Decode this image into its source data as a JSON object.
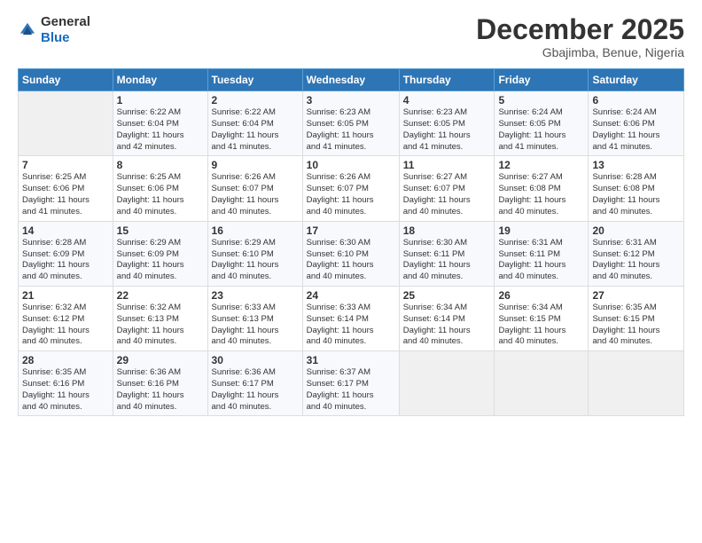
{
  "logo": {
    "general": "General",
    "blue": "Blue"
  },
  "header": {
    "month": "December 2025",
    "location": "Gbajimba, Benue, Nigeria"
  },
  "weekdays": [
    "Sunday",
    "Monday",
    "Tuesday",
    "Wednesday",
    "Thursday",
    "Friday",
    "Saturday"
  ],
  "weeks": [
    [
      {
        "day": "",
        "info": ""
      },
      {
        "day": "1",
        "info": "Sunrise: 6:22 AM\nSunset: 6:04 PM\nDaylight: 11 hours\nand 42 minutes."
      },
      {
        "day": "2",
        "info": "Sunrise: 6:22 AM\nSunset: 6:04 PM\nDaylight: 11 hours\nand 41 minutes."
      },
      {
        "day": "3",
        "info": "Sunrise: 6:23 AM\nSunset: 6:05 PM\nDaylight: 11 hours\nand 41 minutes."
      },
      {
        "day": "4",
        "info": "Sunrise: 6:23 AM\nSunset: 6:05 PM\nDaylight: 11 hours\nand 41 minutes."
      },
      {
        "day": "5",
        "info": "Sunrise: 6:24 AM\nSunset: 6:05 PM\nDaylight: 11 hours\nand 41 minutes."
      },
      {
        "day": "6",
        "info": "Sunrise: 6:24 AM\nSunset: 6:06 PM\nDaylight: 11 hours\nand 41 minutes."
      }
    ],
    [
      {
        "day": "7",
        "info": "Sunrise: 6:25 AM\nSunset: 6:06 PM\nDaylight: 11 hours\nand 41 minutes."
      },
      {
        "day": "8",
        "info": "Sunrise: 6:25 AM\nSunset: 6:06 PM\nDaylight: 11 hours\nand 40 minutes."
      },
      {
        "day": "9",
        "info": "Sunrise: 6:26 AM\nSunset: 6:07 PM\nDaylight: 11 hours\nand 40 minutes."
      },
      {
        "day": "10",
        "info": "Sunrise: 6:26 AM\nSunset: 6:07 PM\nDaylight: 11 hours\nand 40 minutes."
      },
      {
        "day": "11",
        "info": "Sunrise: 6:27 AM\nSunset: 6:07 PM\nDaylight: 11 hours\nand 40 minutes."
      },
      {
        "day": "12",
        "info": "Sunrise: 6:27 AM\nSunset: 6:08 PM\nDaylight: 11 hours\nand 40 minutes."
      },
      {
        "day": "13",
        "info": "Sunrise: 6:28 AM\nSunset: 6:08 PM\nDaylight: 11 hours\nand 40 minutes."
      }
    ],
    [
      {
        "day": "14",
        "info": "Sunrise: 6:28 AM\nSunset: 6:09 PM\nDaylight: 11 hours\nand 40 minutes."
      },
      {
        "day": "15",
        "info": "Sunrise: 6:29 AM\nSunset: 6:09 PM\nDaylight: 11 hours\nand 40 minutes."
      },
      {
        "day": "16",
        "info": "Sunrise: 6:29 AM\nSunset: 6:10 PM\nDaylight: 11 hours\nand 40 minutes."
      },
      {
        "day": "17",
        "info": "Sunrise: 6:30 AM\nSunset: 6:10 PM\nDaylight: 11 hours\nand 40 minutes."
      },
      {
        "day": "18",
        "info": "Sunrise: 6:30 AM\nSunset: 6:11 PM\nDaylight: 11 hours\nand 40 minutes."
      },
      {
        "day": "19",
        "info": "Sunrise: 6:31 AM\nSunset: 6:11 PM\nDaylight: 11 hours\nand 40 minutes."
      },
      {
        "day": "20",
        "info": "Sunrise: 6:31 AM\nSunset: 6:12 PM\nDaylight: 11 hours\nand 40 minutes."
      }
    ],
    [
      {
        "day": "21",
        "info": "Sunrise: 6:32 AM\nSunset: 6:12 PM\nDaylight: 11 hours\nand 40 minutes."
      },
      {
        "day": "22",
        "info": "Sunrise: 6:32 AM\nSunset: 6:13 PM\nDaylight: 11 hours\nand 40 minutes."
      },
      {
        "day": "23",
        "info": "Sunrise: 6:33 AM\nSunset: 6:13 PM\nDaylight: 11 hours\nand 40 minutes."
      },
      {
        "day": "24",
        "info": "Sunrise: 6:33 AM\nSunset: 6:14 PM\nDaylight: 11 hours\nand 40 minutes."
      },
      {
        "day": "25",
        "info": "Sunrise: 6:34 AM\nSunset: 6:14 PM\nDaylight: 11 hours\nand 40 minutes."
      },
      {
        "day": "26",
        "info": "Sunrise: 6:34 AM\nSunset: 6:15 PM\nDaylight: 11 hours\nand 40 minutes."
      },
      {
        "day": "27",
        "info": "Sunrise: 6:35 AM\nSunset: 6:15 PM\nDaylight: 11 hours\nand 40 minutes."
      }
    ],
    [
      {
        "day": "28",
        "info": "Sunrise: 6:35 AM\nSunset: 6:16 PM\nDaylight: 11 hours\nand 40 minutes."
      },
      {
        "day": "29",
        "info": "Sunrise: 6:36 AM\nSunset: 6:16 PM\nDaylight: 11 hours\nand 40 minutes."
      },
      {
        "day": "30",
        "info": "Sunrise: 6:36 AM\nSunset: 6:17 PM\nDaylight: 11 hours\nand 40 minutes."
      },
      {
        "day": "31",
        "info": "Sunrise: 6:37 AM\nSunset: 6:17 PM\nDaylight: 11 hours\nand 40 minutes."
      },
      {
        "day": "",
        "info": ""
      },
      {
        "day": "",
        "info": ""
      },
      {
        "day": "",
        "info": ""
      }
    ]
  ]
}
